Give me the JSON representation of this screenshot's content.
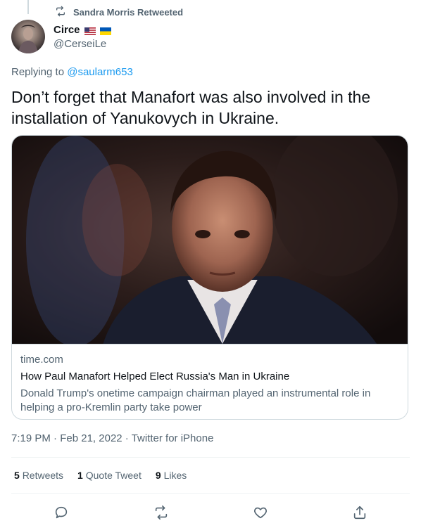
{
  "retweet_context": {
    "label": "Sandra Morris Retweeted"
  },
  "author": {
    "display_name": "Circe",
    "handle": "@CerseiLe",
    "flags": [
      "us-flag",
      "ukraine-flag"
    ]
  },
  "reply": {
    "prefix": "Replying to ",
    "mention": "@saularm653"
  },
  "tweet": {
    "text": "Don’t forget that Manafort was also involved in the installation of Yanukovych in Ukraine."
  },
  "link_card": {
    "domain": "time.com",
    "title": "How Paul Manafort Helped Elect Russia's Man in Ukraine",
    "description": "Donald Trump's onetime campaign chairman played an instrumental role in helping a pro-Kremlin party take power"
  },
  "meta": {
    "time": "7:19 PM",
    "sep1": " · ",
    "date": "Feb 21, 2022",
    "sep2": " · ",
    "source": "Twitter for iPhone"
  },
  "stats": {
    "retweets_count": "5",
    "retweets_label": "Retweets",
    "quotes_count": "1",
    "quotes_label": "Quote Tweet",
    "likes_count": "9",
    "likes_label": "Likes"
  },
  "colors": {
    "text": "#0f1419",
    "secondary": "#536471",
    "accent": "#1d9bf0",
    "border": "#cfd9de"
  },
  "icons": [
    "retweet-icon",
    "reply-icon",
    "like-icon",
    "share-icon"
  ]
}
